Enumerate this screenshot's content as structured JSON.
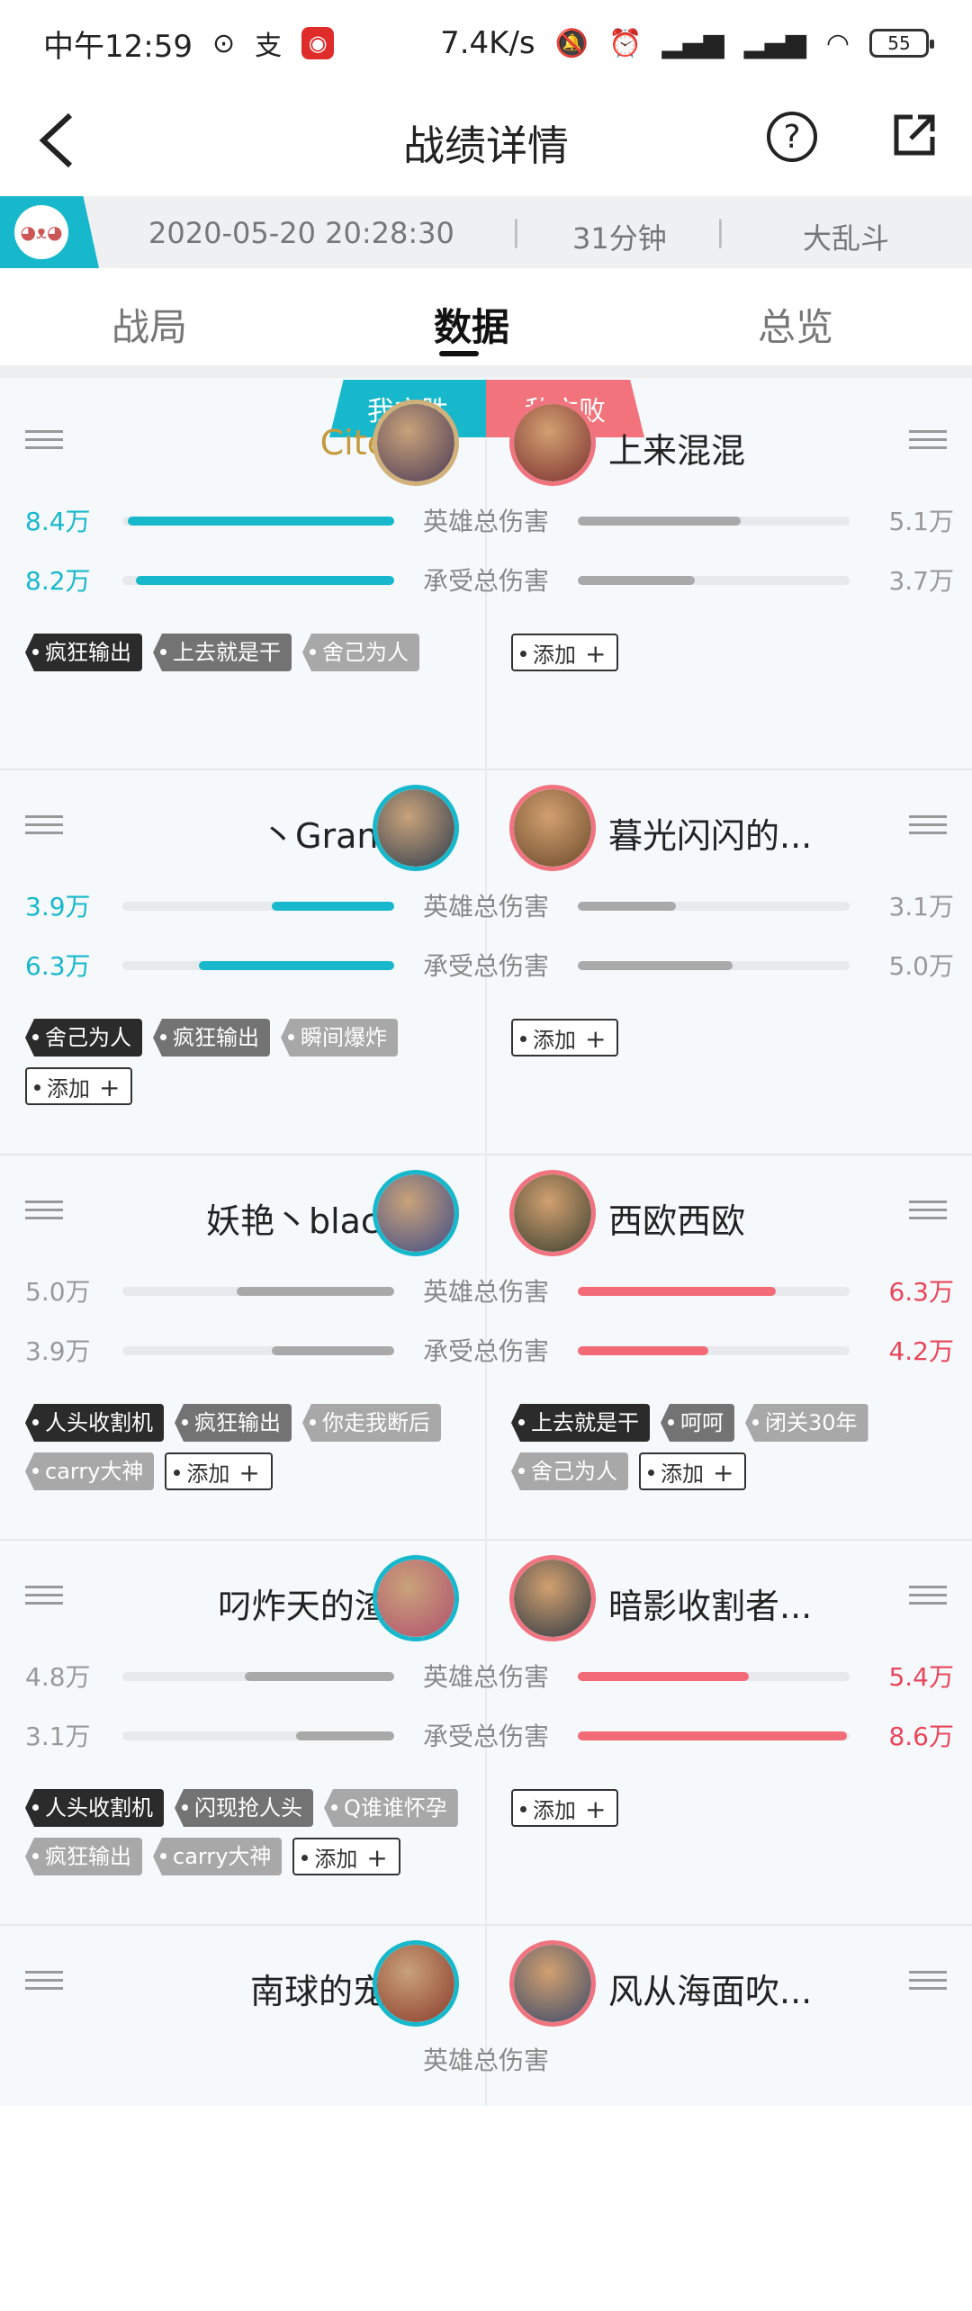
{
  "status_bar": {
    "time": "中午12:59",
    "speed": "7.4K/s",
    "battery": "55"
  },
  "header": {
    "title": "战绩详情"
  },
  "info": {
    "date": "2020-05-20 20:28:30",
    "duration": "31分钟",
    "mode": "大乱斗"
  },
  "tabs": [
    {
      "label": "战局"
    },
    {
      "label": "数据"
    },
    {
      "label": "总览"
    }
  ],
  "result": {
    "ours": "我方胜",
    "theirs": "敌方败"
  },
  "stat_labels": {
    "hero_damage": "英雄总伤害",
    "taken_damage": "承受总伤害"
  },
  "add_label": "添加",
  "matchups": [
    {
      "left": {
        "name": "Citem",
        "hero_damage": "8.4万",
        "taken_damage": "8.2万",
        "hero_fill": 0.98,
        "taken_fill": 0.95,
        "tags": [
          "疯狂输出",
          "上去就是干",
          "舍己为人"
        ]
      },
      "right": {
        "name": "上来混混",
        "hero_damage": "5.1万",
        "taken_damage": "3.7万",
        "hero_fill": 0.6,
        "taken_fill": 0.43,
        "tags": []
      }
    },
    {
      "left": {
        "name": "丶Grande",
        "hero_damage": "3.9万",
        "taken_damage": "6.3万",
        "hero_fill": 0.45,
        "taken_fill": 0.72,
        "tags": [
          "舍己为人",
          "疯狂输出",
          "瞬间爆炸"
        ]
      },
      "right": {
        "name": "暮光闪闪的...",
        "hero_damage": "3.1万",
        "taken_damage": "5.0万",
        "hero_fill": 0.36,
        "taken_fill": 0.57,
        "tags": []
      }
    },
    {
      "left": {
        "name": "妖艳丶black7",
        "hero_damage": "5.0万",
        "taken_damage": "3.9万",
        "hero_fill": 0.58,
        "taken_fill": 0.45,
        "tags": [
          "人头收割机",
          "疯狂输出",
          "你走我断后",
          "carry大神"
        ]
      },
      "right": {
        "name": "西欧西欧",
        "hero_damage": "6.3万",
        "taken_damage": "4.2万",
        "hero_fill": 0.73,
        "taken_fill": 0.48,
        "tags": [
          "上去就是干",
          "呵呵",
          "闭关30年",
          "舍己为人"
        ]
      }
    },
    {
      "left": {
        "name": "叼炸天的渣...",
        "hero_damage": "4.8万",
        "taken_damage": "3.1万",
        "hero_fill": 0.55,
        "taken_fill": 0.36,
        "tags": [
          "人头收割机",
          "闪现抢人头",
          "Q谁谁怀孕",
          "疯狂输出",
          "carry大神"
        ]
      },
      "right": {
        "name": "暗影收割者...",
        "hero_damage": "5.4万",
        "taken_damage": "8.6万",
        "hero_fill": 0.63,
        "taken_fill": 0.99,
        "tags": []
      }
    },
    {
      "left": {
        "name": "南球的宠物"
      },
      "right": {
        "name": "风从海面吹..."
      }
    }
  ]
}
